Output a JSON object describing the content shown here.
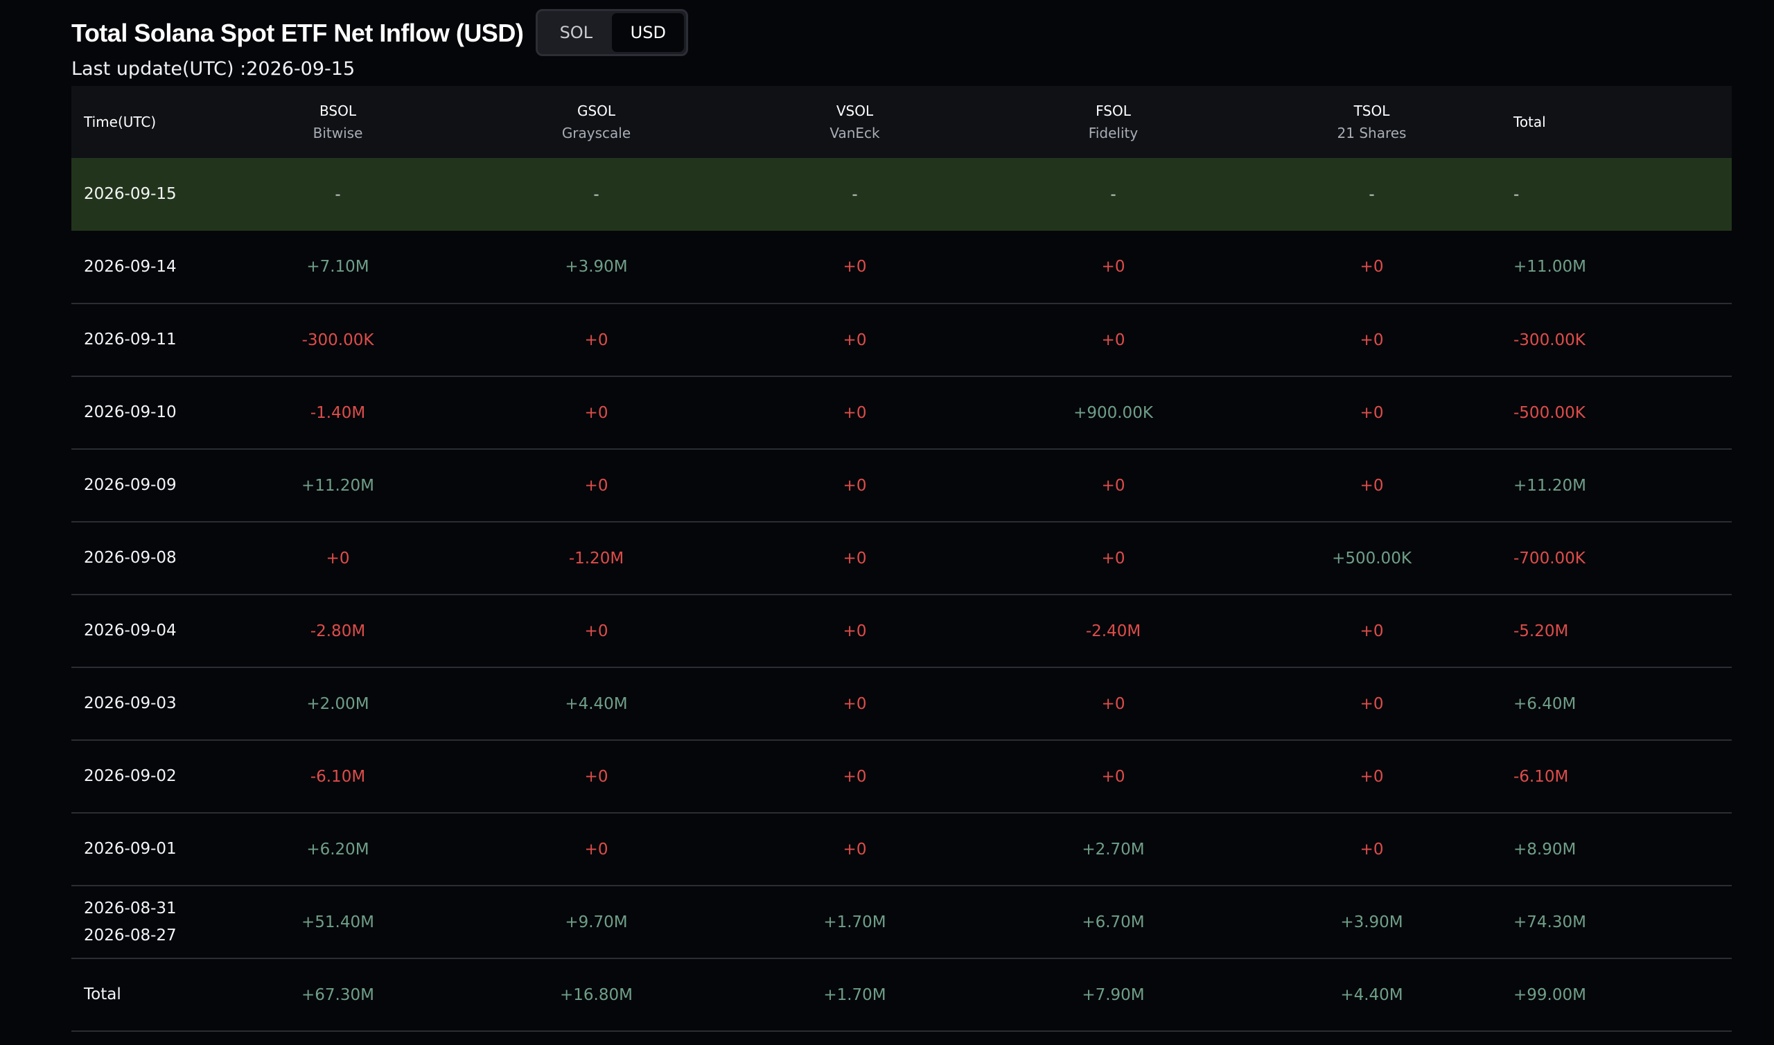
{
  "header": {
    "title": "Total Solana Spot ETF Net Inflow (USD)",
    "toggle": {
      "options": [
        "SOL",
        "USD"
      ],
      "selected": "USD"
    },
    "last_update": "Last update(UTC) :2026-09-15"
  },
  "table": {
    "time_header": "Time(UTC)",
    "total_header": "Total",
    "funds": [
      {
        "code": "BSOL",
        "issuer": "Bitwise"
      },
      {
        "code": "GSOL",
        "issuer": "Grayscale"
      },
      {
        "code": "VSOL",
        "issuer": "VanEck"
      },
      {
        "code": "FSOL",
        "issuer": "Fidelity"
      },
      {
        "code": "TSOL",
        "issuer": "21 Shares"
      }
    ],
    "rows": [
      {
        "date": "2026-09-15",
        "values": [
          "-",
          "-",
          "-",
          "-",
          "-"
        ],
        "total": "-",
        "highlight": true
      },
      {
        "date": "2026-09-14",
        "values": [
          "+7.10M",
          "+3.90M",
          "+0",
          "+0",
          "+0"
        ],
        "total": "+11.00M"
      },
      {
        "date": "2026-09-11",
        "values": [
          "-300.00K",
          "+0",
          "+0",
          "+0",
          "+0"
        ],
        "total": "-300.00K"
      },
      {
        "date": "2026-09-10",
        "values": [
          "-1.40M",
          "+0",
          "+0",
          "+900.00K",
          "+0"
        ],
        "total": "-500.00K"
      },
      {
        "date": "2026-09-09",
        "values": [
          "+11.20M",
          "+0",
          "+0",
          "+0",
          "+0"
        ],
        "total": "+11.20M"
      },
      {
        "date": "2026-09-08",
        "values": [
          "+0",
          "-1.20M",
          "+0",
          "+0",
          "+500.00K"
        ],
        "total": "-700.00K"
      },
      {
        "date": "2026-09-04",
        "values": [
          "-2.80M",
          "+0",
          "+0",
          "-2.40M",
          "+0"
        ],
        "total": "-5.20M"
      },
      {
        "date": "2026-09-03",
        "values": [
          "+2.00M",
          "+4.40M",
          "+0",
          "+0",
          "+0"
        ],
        "total": "+6.40M"
      },
      {
        "date": "2026-09-02",
        "values": [
          "-6.10M",
          "+0",
          "+0",
          "+0",
          "+0"
        ],
        "total": "-6.10M"
      },
      {
        "date": "2026-09-01",
        "values": [
          "+6.20M",
          "+0",
          "+0",
          "+2.70M",
          "+0"
        ],
        "total": "+8.90M"
      },
      {
        "date": "2026-08-31",
        "date2": "2026-08-27",
        "values": [
          "+51.40M",
          "+9.70M",
          "+1.70M",
          "+6.70M",
          "+3.90M"
        ],
        "total": "+74.30M"
      },
      {
        "date": "Total",
        "values": [
          "+67.30M",
          "+16.80M",
          "+1.70M",
          "+7.90M",
          "+4.40M"
        ],
        "total": "+99.00M"
      }
    ]
  },
  "colors": {
    "positive": "#6f9f88",
    "negative": "#dd4d4a",
    "highlight_row": "#22351c",
    "background": "#05060a"
  }
}
